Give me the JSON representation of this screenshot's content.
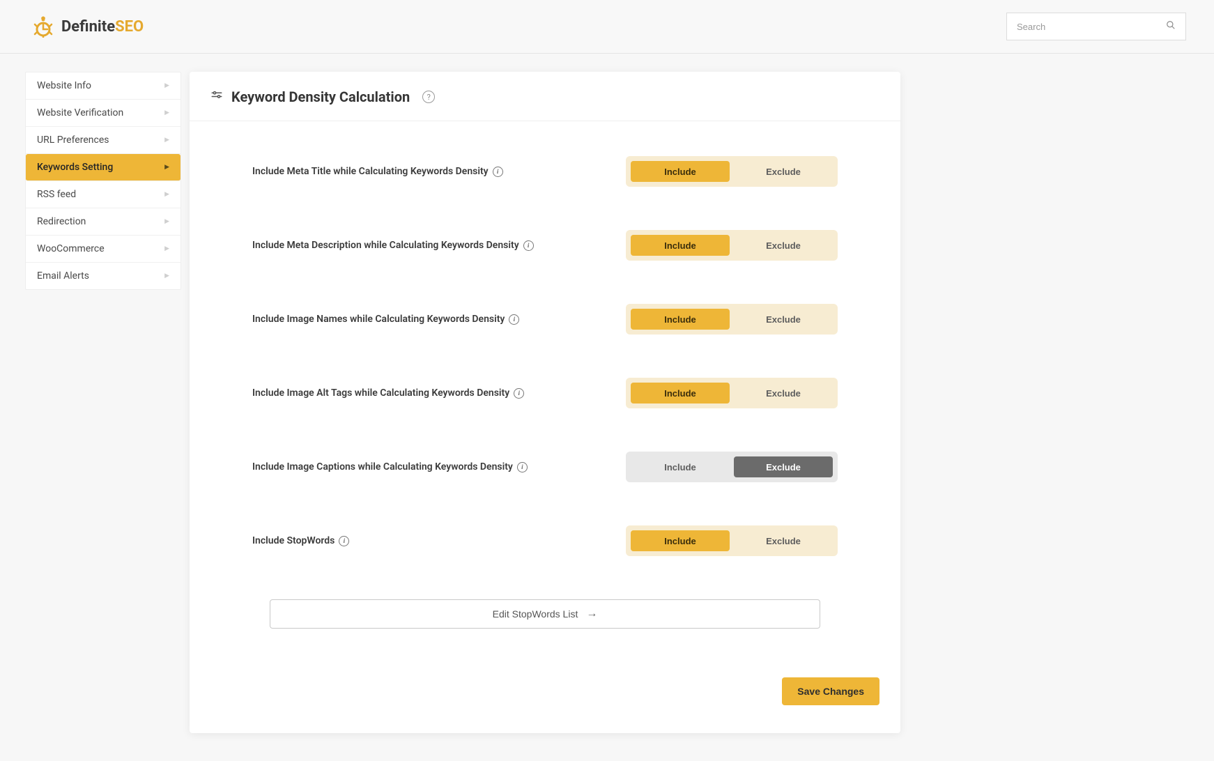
{
  "brand": {
    "name_main": "Definite",
    "name_accent": "SEO"
  },
  "search": {
    "placeholder": "Search"
  },
  "sidebar": {
    "items": [
      {
        "label": "Website Info",
        "active": false
      },
      {
        "label": "Website Verification",
        "active": false
      },
      {
        "label": "URL Preferences",
        "active": false
      },
      {
        "label": "Keywords Setting",
        "active": true
      },
      {
        "label": "RSS feed",
        "active": false
      },
      {
        "label": "Redirection",
        "active": false
      },
      {
        "label": "WooCommerce",
        "active": false
      },
      {
        "label": "Email Alerts",
        "active": false
      }
    ]
  },
  "panel": {
    "title": "Keyword Density Calculation",
    "settings": [
      {
        "label": "Include Meta Title while Calculating Keywords Density",
        "value": "include"
      },
      {
        "label": "Include Meta Description while Calculating Keywords Density",
        "value": "include"
      },
      {
        "label": "Include Image Names while Calculating Keywords Density",
        "value": "include"
      },
      {
        "label": "Include Image Alt Tags while Calculating Keywords Density",
        "value": "include"
      },
      {
        "label": "Include Image Captions while Calculating Keywords Density",
        "value": "exclude"
      },
      {
        "label": "Include StopWords",
        "value": "include"
      }
    ],
    "toggle_labels": {
      "include": "Include",
      "exclude": "Exclude"
    },
    "edit_stopwords_label": "Edit StopWords List",
    "save_label": "Save Changes"
  }
}
